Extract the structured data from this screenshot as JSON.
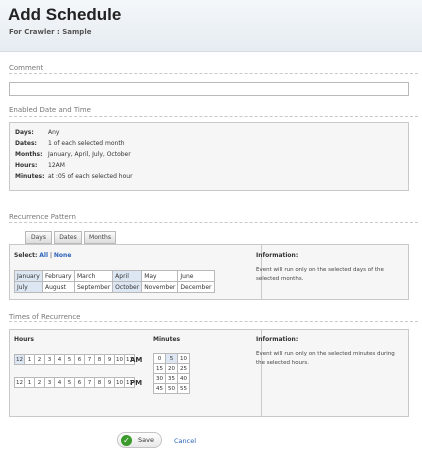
{
  "header": {
    "title": "Add Schedule",
    "subtitle": "For Crawler : Sample"
  },
  "comment": {
    "label": "Comment",
    "value": ""
  },
  "enabled": {
    "label": "Enabled Date and Time",
    "rows": [
      {
        "key": "Days:",
        "value": "Any"
      },
      {
        "key": "Dates:",
        "value": "1 of each selected month"
      },
      {
        "key": "Months:",
        "value": "January, April, July, October"
      },
      {
        "key": "Hours:",
        "value": "12AM"
      },
      {
        "key": "Minutes:",
        "value": "at :05 of each selected hour"
      }
    ]
  },
  "recurrence": {
    "label": "Recurrence Pattern",
    "tabs": [
      "Days",
      "Dates",
      "Months"
    ],
    "select_label": "Select:",
    "all": "All",
    "separator": "|",
    "none": "None",
    "months": [
      [
        {
          "name": "January",
          "on": true
        },
        {
          "name": "February",
          "on": false
        },
        {
          "name": "March",
          "on": false
        },
        {
          "name": "April",
          "on": true
        },
        {
          "name": "May",
          "on": false
        },
        {
          "name": "June",
          "on": false
        }
      ],
      [
        {
          "name": "July",
          "on": true
        },
        {
          "name": "August",
          "on": false
        },
        {
          "name": "September",
          "on": false
        },
        {
          "name": "October",
          "on": true
        },
        {
          "name": "November",
          "on": false
        },
        {
          "name": "December",
          "on": false
        }
      ]
    ],
    "info_title": "Information:",
    "info_text": "Event will run only on the selected days of the selected months."
  },
  "times": {
    "label": "Times of Recurrence",
    "hours_label": "Hours",
    "minutes_label": "Minutes",
    "am_hours": [
      {
        "v": "12",
        "on": true
      },
      {
        "v": "1",
        "on": false
      },
      {
        "v": "2",
        "on": false
      },
      {
        "v": "3",
        "on": false
      },
      {
        "v": "4",
        "on": false
      },
      {
        "v": "5",
        "on": false
      },
      {
        "v": "6",
        "on": false
      },
      {
        "v": "7",
        "on": false
      },
      {
        "v": "8",
        "on": false
      },
      {
        "v": "9",
        "on": false
      },
      {
        "v": "10",
        "on": false
      },
      {
        "v": "11",
        "on": false
      }
    ],
    "pm_hours": [
      {
        "v": "12",
        "on": false
      },
      {
        "v": "1",
        "on": false
      },
      {
        "v": "2",
        "on": false
      },
      {
        "v": "3",
        "on": false
      },
      {
        "v": "4",
        "on": false
      },
      {
        "v": "5",
        "on": false
      },
      {
        "v": "6",
        "on": false
      },
      {
        "v": "7",
        "on": false
      },
      {
        "v": "8",
        "on": false
      },
      {
        "v": "9",
        "on": false
      },
      {
        "v": "10",
        "on": false
      },
      {
        "v": "11",
        "on": false
      }
    ],
    "am": "AM",
    "pm": "PM",
    "minutes": [
      [
        {
          "v": "0",
          "on": false
        },
        {
          "v": "5",
          "on": true
        },
        {
          "v": "10",
          "on": false
        }
      ],
      [
        {
          "v": "15",
          "on": false
        },
        {
          "v": "20",
          "on": false
        },
        {
          "v": "25",
          "on": false
        }
      ],
      [
        {
          "v": "30",
          "on": false
        },
        {
          "v": "35",
          "on": false
        },
        {
          "v": "40",
          "on": false
        }
      ],
      [
        {
          "v": "45",
          "on": false
        },
        {
          "v": "50",
          "on": false
        },
        {
          "v": "55",
          "on": false
        }
      ]
    ],
    "info_title": "Information:",
    "info_text": "Event will run only on the selected minutes during the selected hours."
  },
  "actions": {
    "save": "Save",
    "cancel": "Cancel"
  },
  "colors": {
    "selected_cell": "#dde7f3",
    "link": "#2a62b8",
    "save_icon": "#3a9a2a"
  }
}
